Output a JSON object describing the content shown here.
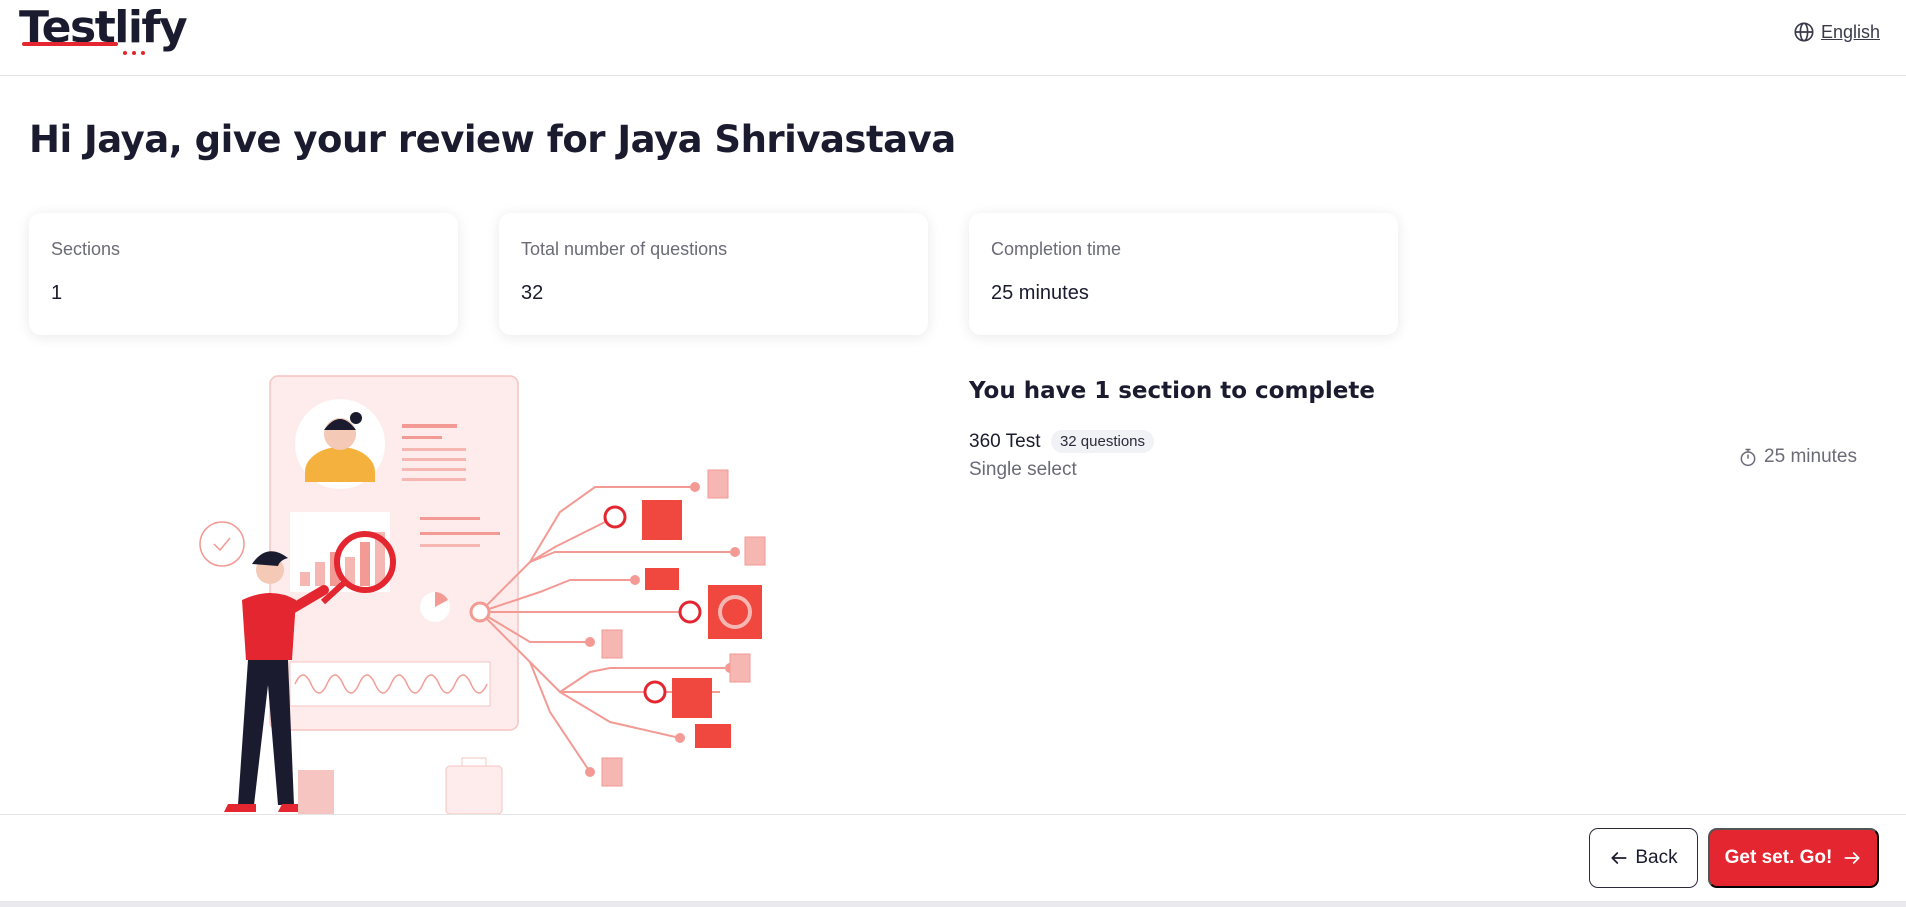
{
  "brand": {
    "name": "Testlify",
    "accent": "#e3262f"
  },
  "header": {
    "language_label": "English",
    "language_icon": "globe-icon"
  },
  "page": {
    "title": "Hi Jaya, give your review for Jaya Shrivastava"
  },
  "stats": [
    {
      "label": "Sections",
      "value": "1"
    },
    {
      "label": "Total number of questions",
      "value": "32"
    },
    {
      "label": "Completion time",
      "value": "25 minutes"
    }
  ],
  "sections": {
    "heading": "You have 1 section to complete",
    "items": [
      {
        "name": "360 Test",
        "questions_badge": "32 questions",
        "type": "Single select",
        "time": "25 minutes",
        "time_icon": "stopwatch-icon"
      }
    ]
  },
  "footer": {
    "back_label": "Back",
    "back_icon": "arrow-left-icon",
    "go_label": "Get set. Go!",
    "go_icon": "arrow-right-icon"
  }
}
